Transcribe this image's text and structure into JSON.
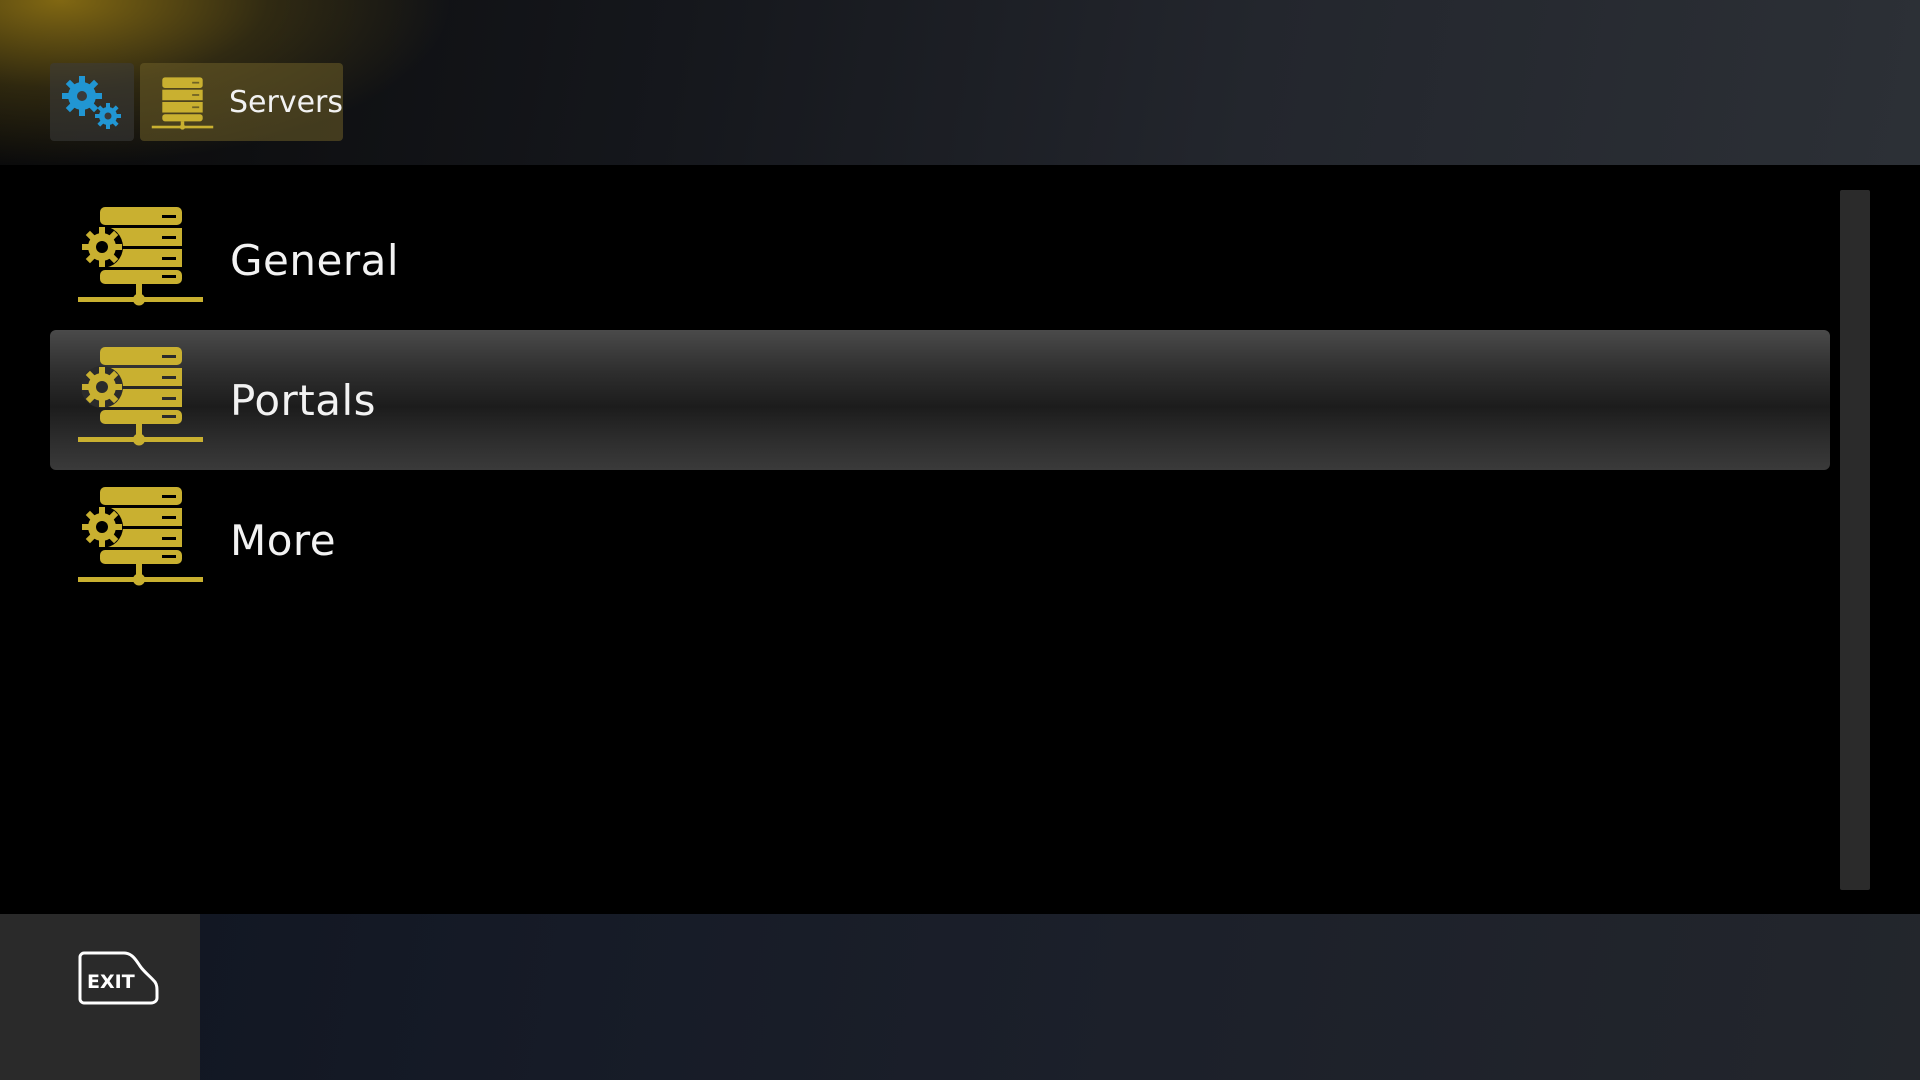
{
  "header": {
    "settings_icon": "gears-icon",
    "breadcrumb_label": "Servers",
    "breadcrumb_icon": "server-icon"
  },
  "menu": {
    "items": [
      {
        "label": "General",
        "icon": "server-settings-icon",
        "selected": false
      },
      {
        "label": "Portals",
        "icon": "server-settings-icon",
        "selected": true
      },
      {
        "label": "More",
        "icon": "server-settings-icon",
        "selected": false
      }
    ]
  },
  "footer": {
    "exit_label": "EXIT",
    "exit_icon": "exit-icon"
  },
  "colors": {
    "accent_gold": "#c9b030",
    "gear_blue": "#2196d3"
  }
}
